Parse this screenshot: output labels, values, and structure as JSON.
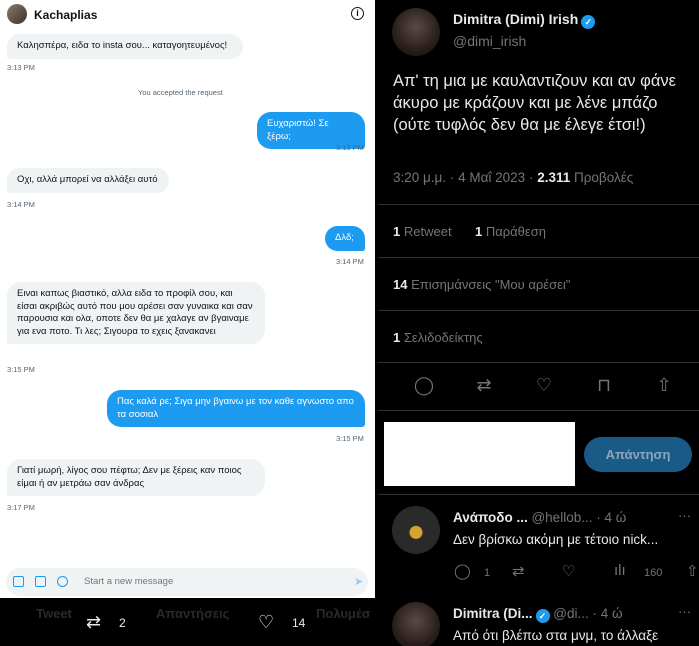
{
  "dm": {
    "contact_name": "Kachaplias",
    "messages": [
      {
        "dir": "in",
        "text": "Καλησπέρα, ειδα το insta σου... καταγοητευμένος!",
        "time": "3:13 PM"
      },
      {
        "dir": "system",
        "text": "You accepted the request"
      },
      {
        "dir": "out",
        "text": "Ευχαριστώ! Σε ξέρω;",
        "time": "3:13 PM"
      },
      {
        "dir": "in",
        "text": "Οχι, αλλά μπορεί να αλλάξει αυτό",
        "time": "3:14 PM"
      },
      {
        "dir": "out",
        "text": "Δλδ;",
        "time": "3:14 PM"
      },
      {
        "dir": "in",
        "text": "Ειναι καπως βιαστικό, αλλα ειδα το προφίλ σου, και είσαι ακριβώς αυτό που μου αρέσει σαν γυναικα και σαν παρουσια και ολα, οποτε δεν θα με χαλαγε αν βγαιναμε για ενα ποτο. Τι λες; Σιγουρα το εχεις ξανακανει",
        "time": "3:15 PM"
      },
      {
        "dir": "out",
        "text": "Πας καλά ρε; Σιγα μην βγαινω με τον καθε αγνωστο απο τα σοσιαλ",
        "time": "3:15 PM"
      },
      {
        "dir": "in",
        "text": "Γιατί μωρή, λίγος σου πέφτω; Δεν με ξέρεις καν ποιος είμαι ή αν μετράω σαν άνδρας",
        "time": "3:17 PM"
      }
    ],
    "composer_placeholder": "Start a new message"
  },
  "bottom_bar": {
    "tabs": [
      "Tweet",
      "Απαντήσεις",
      "Πολυμέσ"
    ],
    "retweet_count": "2",
    "like_count": "14"
  },
  "tweet": {
    "author_name": "Dimitra (Dimi) Irish",
    "handle": "@dimi_irish",
    "text": "Απ' τη μια με καυλαντιζουν και αν φάνε άκυρο με κράζουν και με λένε μπάζο (ούτε τυφλός δεν θα με έλεγε έτσι!)",
    "time": "3:20 μ.μ.",
    "date": "4 Μαΐ 2023",
    "views_count": "2.311",
    "views_label": "Προβολές",
    "retweets_count": "1",
    "retweets_label": "Retweet",
    "quotes_count": "1",
    "quotes_label": "Παράθεση",
    "likes_count": "14",
    "likes_label": "Επισημάνσεις \"Μου αρέσει\"",
    "bookmarks_count": "1",
    "bookmarks_label": "Σελιδοδείκτης",
    "reply_button_label": "Απάντηση"
  },
  "replies": [
    {
      "name": "Ανάποδο ...",
      "handle": "@hellob...",
      "time": "· 4 ώ",
      "text": "Δεν βρίσκω ακόμη με τέτοιο nick...",
      "reply_count": "1",
      "view_count": "160"
    },
    {
      "name": "Dimitra (Di...",
      "handle": "@di...",
      "time": "· 4 ώ",
      "text": "Από ότι βλέπω στα μνμ, το άλλαξε"
    }
  ],
  "colors": {
    "accent": "#1d9bf0",
    "bg_dark": "#000000",
    "bubble_in": "#eff3f4"
  }
}
